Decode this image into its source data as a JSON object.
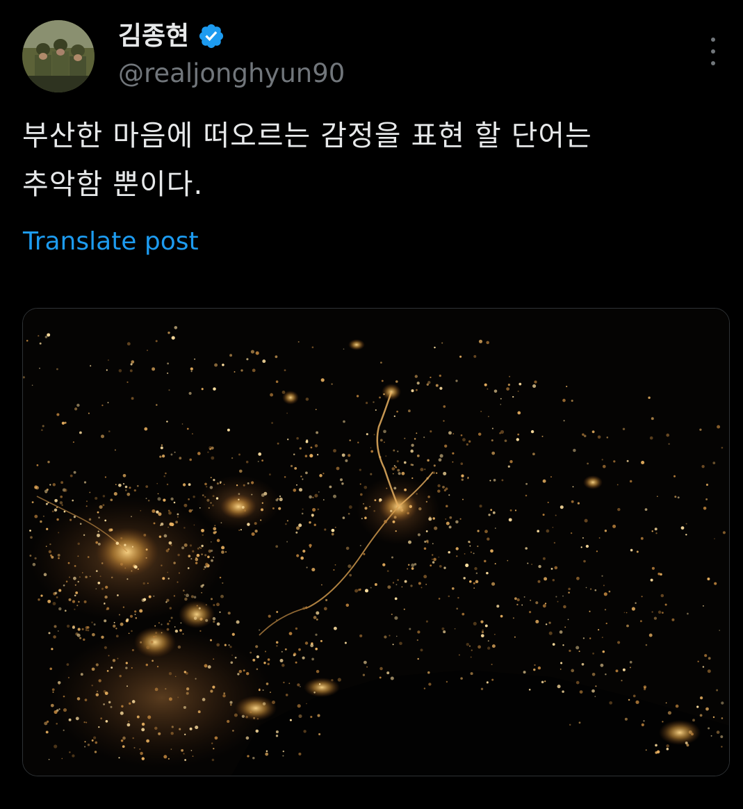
{
  "author": {
    "display_name": "김종현",
    "handle": "@realjonghyun90",
    "verified": true,
    "avatar_icon": "avatar-photo",
    "verified_icon": "verified-badge-icon",
    "verified_color": "#1d9bf0"
  },
  "more_icon": "more-options-icon",
  "tweet": {
    "text_line1": "부산한 마음에 떠오르는 감정을 표현 할 단어는",
    "text_line2": "추악함 뿐이다.",
    "translate_label": "Translate post"
  },
  "media": {
    "kind": "night-satellite-photo",
    "colors": {
      "background": "#050403",
      "city_light": "#f5c060"
    }
  },
  "colors": {
    "background": "#000000",
    "text": "#e7e9ea",
    "muted": "#71767b",
    "link": "#1d9bf0"
  }
}
